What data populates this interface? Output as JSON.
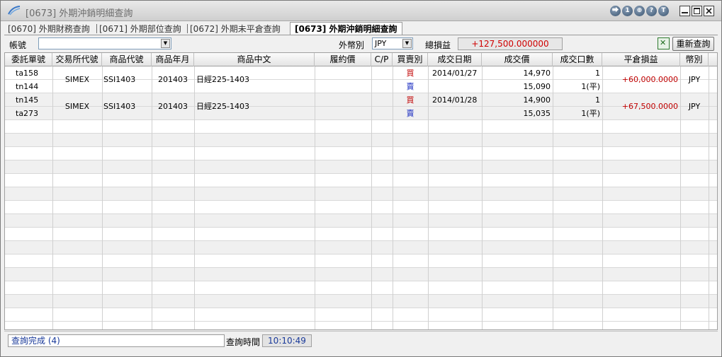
{
  "window": {
    "title": "[0673] 外期沖銷明細查詢"
  },
  "title_buttons": [
    "⮕",
    "1",
    "⊕",
    "?",
    "T"
  ],
  "tabs": [
    {
      "label": "[0670] 外期財務查詢",
      "active": false
    },
    {
      "label": "[0671] 外期部位查詢",
      "active": false
    },
    {
      "label": "[0672] 外期未平倉查詢",
      "active": false
    },
    {
      "label": "[0673] 外期沖銷明細查詢",
      "active": true
    }
  ],
  "query": {
    "account_label": "帳號",
    "account_value": "",
    "currency_label": "外幣別",
    "currency_value": "JPY",
    "total_pl_label": "總損益",
    "total_pl_value": "+127,500.000000",
    "requery_label": "重新查詢"
  },
  "table": {
    "headers": [
      "委託單號",
      "交易所代號",
      "商品代號",
      "商品年月",
      "商品中文",
      "履約價",
      "C/P",
      "買賣別",
      "成交日期",
      "成交價",
      "成交口數",
      "平倉損益",
      "幣別"
    ],
    "groups": [
      {
        "exchange": "SIMEX",
        "product_code": "SSI1403",
        "year_month": "201403",
        "product_name": "日經225-1403",
        "pl": "+60,000.0000",
        "currency": "JPY",
        "rows": [
          {
            "order_no": "ta158",
            "strike": "",
            "cp": "",
            "side": "買",
            "date": "2014/01/27",
            "price": "14,970",
            "qty": "1"
          },
          {
            "order_no": "tn144",
            "strike": "",
            "cp": "",
            "side": "賣",
            "date": "",
            "price": "15,090",
            "qty": "1(平)"
          }
        ]
      },
      {
        "exchange": "SIMEX",
        "product_code": "SSI1403",
        "year_month": "201403",
        "product_name": "日經225-1403",
        "pl": "+67,500.0000",
        "currency": "JPY",
        "rows": [
          {
            "order_no": "tn145",
            "strike": "",
            "cp": "",
            "side": "買",
            "date": "2014/01/28",
            "price": "14,900",
            "qty": "1"
          },
          {
            "order_no": "ta273",
            "strike": "",
            "cp": "",
            "side": "賣",
            "date": "",
            "price": "15,035",
            "qty": "1(平)"
          }
        ]
      }
    ]
  },
  "status": {
    "message": "查詢完成 (4)",
    "query_time_label": "查詢時間",
    "query_time_value": "10:10:49"
  },
  "colors": {
    "profit": "#c00000",
    "buy": "#c00000",
    "sell": "#1a2cc0",
    "status_text": "#1a3a9a"
  }
}
